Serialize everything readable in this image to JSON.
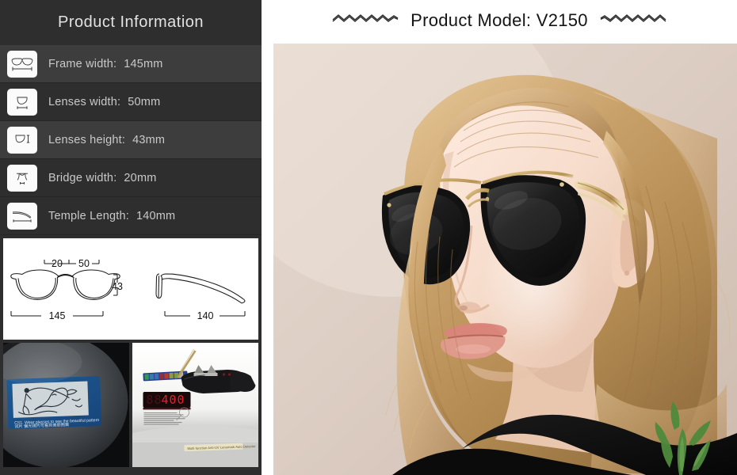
{
  "sidebar": {
    "title": "Product Information",
    "specs": [
      {
        "icon": "glasses-front-icon",
        "label": "Frame width:",
        "value": "145mm"
      },
      {
        "icon": "lens-width-icon",
        "label": "Lenses width:",
        "value": "50mm"
      },
      {
        "icon": "lens-height-icon",
        "label": "Lenses height:",
        "value": "43mm"
      },
      {
        "icon": "bridge-width-icon",
        "label": "Bridge width:",
        "value": "20mm"
      },
      {
        "icon": "temple-length-icon",
        "label": "Temple Length:",
        "value": "140mm"
      }
    ],
    "diagram": {
      "bridge": "20",
      "lens_width": "50",
      "lens_height": "43",
      "frame_width": "145",
      "temple_length": "140"
    },
    "photos": [
      {
        "name": "polarized-lens-test-card-photo",
        "caption": ""
      },
      {
        "name": "uv-tester-device-photo",
        "display_value": "400"
      }
    ]
  },
  "main": {
    "title": "Product Model:  V2150",
    "ornament_left": "zigzag-ornament",
    "ornament_right": "zigzag-ornament",
    "photo_name": "model-wearing-sunglasses-photo"
  },
  "colors": {
    "panel_bg": "#2e2e2e",
    "row_odd": "#3d3d3d",
    "row_even": "#2e2e2e",
    "text": "#c9c9c9",
    "title_text": "#e2e2e2",
    "icon_bg": "#fbfbfb",
    "header_text": "#141414",
    "photo_bg": "#d9cbc2"
  }
}
